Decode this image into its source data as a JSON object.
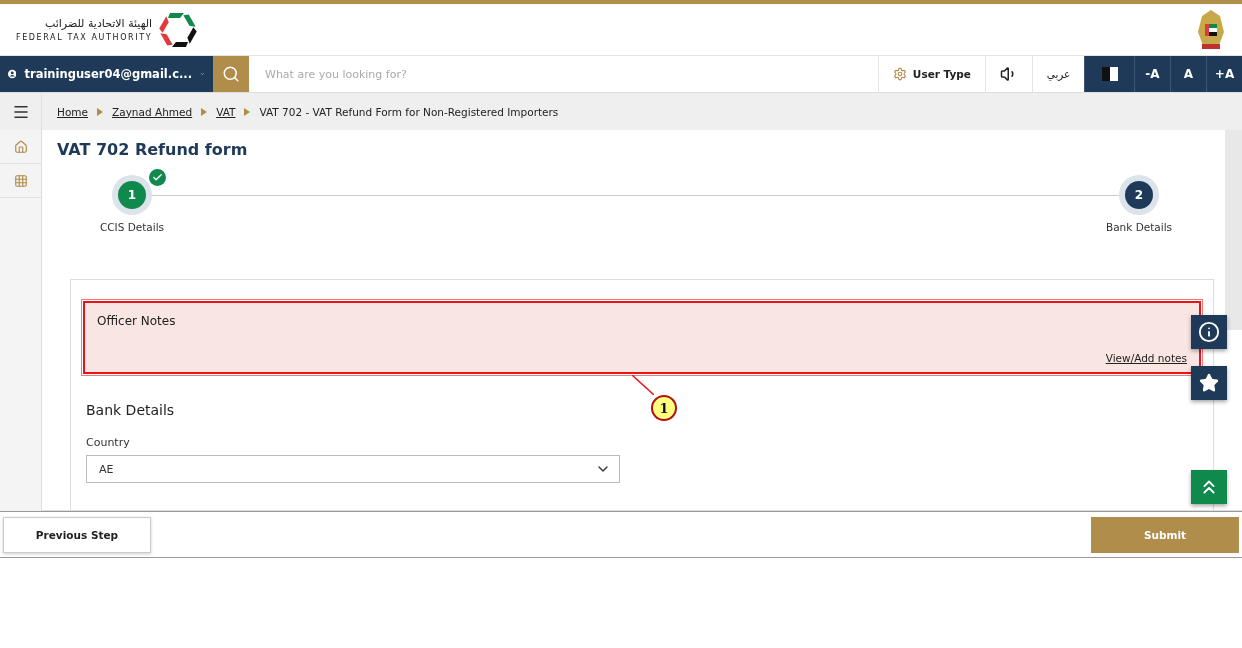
{
  "header": {
    "org_arabic": "الهيئة الاتحادية للضرائب",
    "org_name": "FEDERAL TAX AUTHORITY"
  },
  "nav": {
    "user": "traininguser04@gmail.c...",
    "search": {
      "placeholder": "What are you looking for?"
    },
    "user_type": "User Type",
    "language": "عربي",
    "font_buttons": [
      "-A",
      "A",
      "+A"
    ]
  },
  "breadcrumb": [
    {
      "label": "Home",
      "link": true
    },
    {
      "label": "Zaynad Ahmed",
      "link": true
    },
    {
      "label": "VAT",
      "link": true
    },
    {
      "label": "VAT 702 - VAT Refund Form for Non-Registered Importers",
      "link": false
    }
  ],
  "page_title": "VAT 702 Refund form",
  "steps": [
    {
      "number": "1",
      "label": "CCIS Details",
      "completed": true
    },
    {
      "number": "2",
      "label": "Bank Details",
      "completed": false
    }
  ],
  "officer_notes": {
    "title": "Officer Notes",
    "link": "View/Add notes"
  },
  "annotation": {
    "label": "1"
  },
  "bank_details": {
    "title": "Bank Details",
    "fields": [
      {
        "label": "Country",
        "value": "AE"
      }
    ]
  },
  "footer": {
    "previous": "Previous Step",
    "submit": "Submit"
  }
}
